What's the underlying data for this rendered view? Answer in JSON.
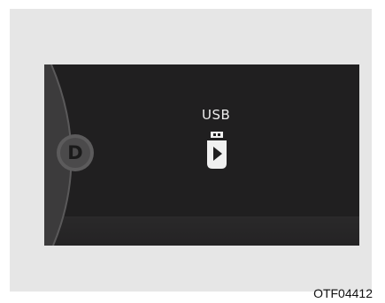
{
  "screen": {
    "source_label": "USB",
    "icon": "usb-play-icon",
    "gear_indicator": "D"
  },
  "figure_code": "OTF04412",
  "colors": {
    "background": "#e6e6e6",
    "screen": "#201f20",
    "label": "#ededed"
  }
}
